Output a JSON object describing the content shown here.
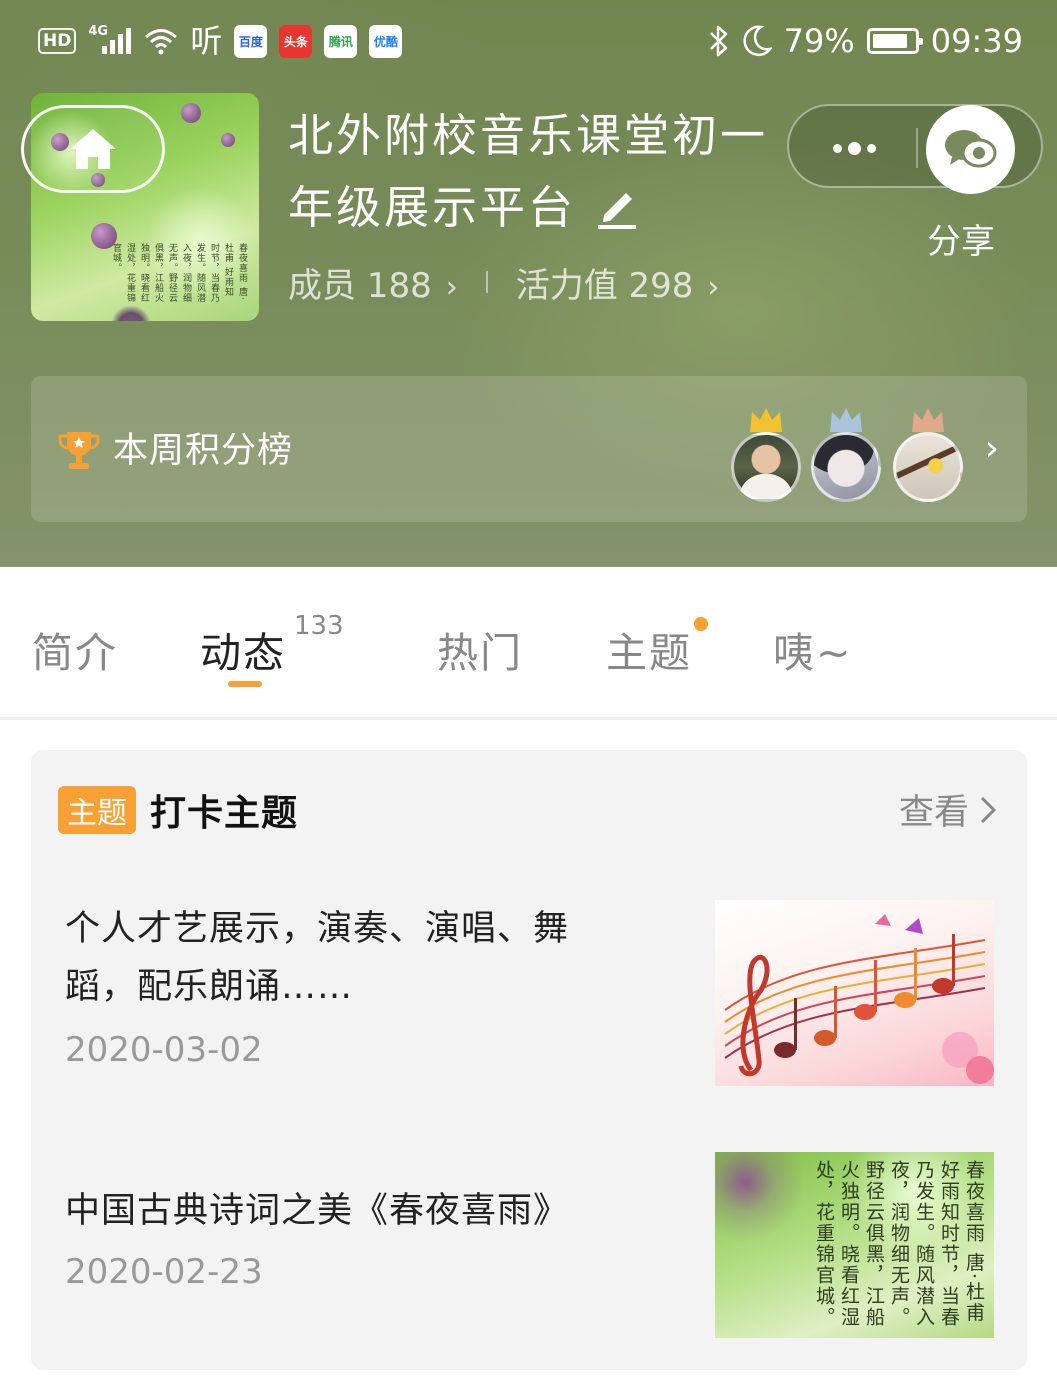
{
  "status_bar": {
    "hd": "HD",
    "network": "4G",
    "ting": "听",
    "apps": [
      "百度",
      "头条",
      "腾讯",
      "优酷"
    ],
    "battery": "79%",
    "time": "09:39"
  },
  "group": {
    "title_line1": "北外附校音乐课堂初一",
    "title_line2": "年级展示平台",
    "members_label": "成员 188",
    "activity_label": "活力值 298",
    "share_label": "分享",
    "cover_poem": "春夜喜雨 唐·杜甫 好雨知时节，当春乃发生。随风潜入夜，润物细无声。野径云俱黑，江船火独明。晓看红湿处，花重锦官城。"
  },
  "ranking": {
    "label": "本周积分榜",
    "crown_colors": [
      "#f2c230",
      "#a9c4dc",
      "#e0a98a"
    ]
  },
  "tabs": [
    {
      "label": "简介"
    },
    {
      "label": "动态",
      "count": "133"
    },
    {
      "label": "热门"
    },
    {
      "label": "主题"
    },
    {
      "label": "咦~"
    }
  ],
  "topic_card": {
    "badge": "主题",
    "heading": "打卡主题",
    "view_label": "查看",
    "items": [
      {
        "text_line1": "个人才艺展示，演奏、演唱、舞",
        "text_line2": "蹈，配乐朗诵……",
        "date": "2020-03-02"
      },
      {
        "text_line1": "中国古典诗词之美《春夜喜雨》",
        "date": "2020-02-23",
        "thumb_poem": "春夜喜雨 唐·杜甫 好雨知时节，当春乃发生。随风潜入夜，润物细无声。野径云俱黑，江船火独明。晓看红湿处，花重锦官城。"
      }
    ]
  },
  "colors": {
    "accent": "#f7a134",
    "header_green": "#758a56",
    "card_bg": "#f3f3f3"
  }
}
